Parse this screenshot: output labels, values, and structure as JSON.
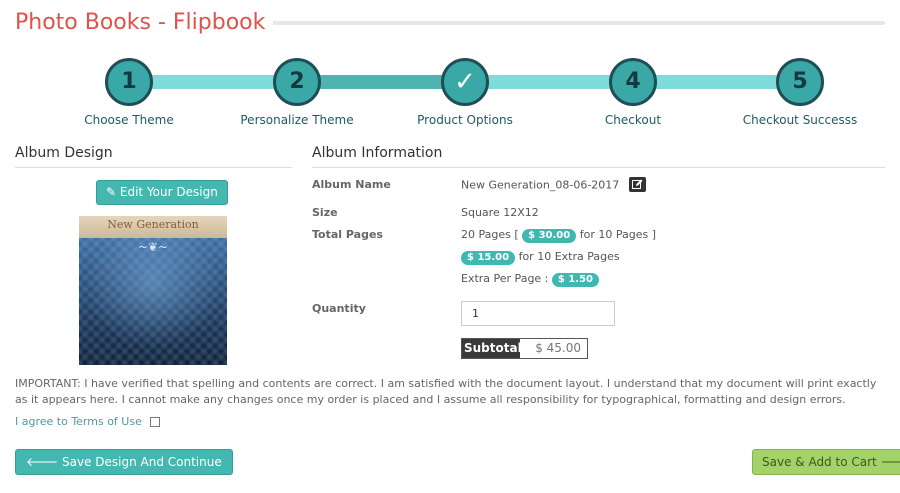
{
  "page": {
    "title": "Photo Books - Flipbook"
  },
  "steps": [
    {
      "marker": "1",
      "label": "Choose Theme"
    },
    {
      "marker": "2",
      "label": "Personalize Theme"
    },
    {
      "marker": "✓",
      "label": "Product Options"
    },
    {
      "marker": "4",
      "label": "Checkout"
    },
    {
      "marker": "5",
      "label": "Checkout Successs"
    }
  ],
  "album_design": {
    "heading": "Album Design",
    "edit_button": "Edit Your Design",
    "cover_title": "New Generation"
  },
  "album_info": {
    "heading": "Album Information",
    "name_label": "Album Name",
    "name_value": "New Generation_08-06-2017",
    "size_label": "Size",
    "size_value": "Square 12X12",
    "pages_label": "Total Pages",
    "pages_prefix": "20 Pages [",
    "pages_price": "$ 30.00",
    "pages_suffix": "for 10 Pages ]",
    "extra_price": "$ 15.00",
    "extra_suffix": "for 10 Extra Pages",
    "per_page_prefix": "Extra Per Page :",
    "per_page_price": "$ 1.50",
    "quantity_label": "Quantity",
    "quantity_value": "1",
    "subtotal_label": "Subtotal",
    "subtotal_value": "$ 45.00"
  },
  "notice": {
    "important": "IMPORTANT: I have verified that spelling and contents are correct. I am satisfied with the document layout. I understand that my document will print exactly as it appears here. I cannot make any changes once my order is placed and I assume all responsibility for typographical, formatting and design errors.",
    "terms_label": "I agree to Terms of Use"
  },
  "actions": {
    "save_label": "Save Design And Continue",
    "cart_label": "Save & Add to Cart"
  },
  "colors": {
    "title": "#e0524b",
    "accent": "#45b7b1",
    "cart": "#a3d26a"
  }
}
